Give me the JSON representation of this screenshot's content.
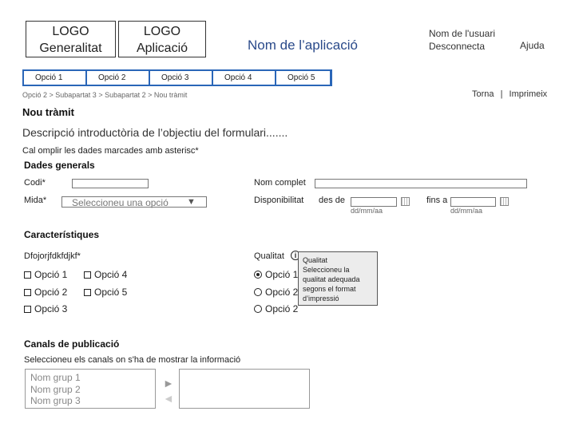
{
  "header": {
    "logo_generalitat": [
      "LOGO",
      "Generalitat"
    ],
    "logo_aplicacio": [
      "LOGO",
      "Aplicació"
    ],
    "app_name": "Nom de l’aplicació",
    "user_name": "Nom de l'usuari",
    "logout": "Desconnecta",
    "help": "Ajuda"
  },
  "nav": {
    "items": [
      "Opció 1",
      "Opció 2",
      "Opció 3",
      "Opció 4",
      "Opció 5"
    ]
  },
  "breadcrumb": "Opció 2 > Subapartat 3 > Subapartat 2 > Nou tràmit",
  "actions": {
    "back": "Torna",
    "separator": "|",
    "print": "Imprimeix"
  },
  "page": {
    "title": "Nou tràmit",
    "intro": "Descripció introductòria de l’objectiu del formulari.......",
    "required_note": "Cal omplir les dades marcades amb asterisc*"
  },
  "general": {
    "heading": "Dades generals",
    "codi_label": "Codi*",
    "nom_label": "Nom complet",
    "mida_label": "Mida*",
    "mida_placeholder": "Seleccioneu una opció",
    "select_arrow": "▼",
    "disponibilitat_label": "Disponibilitat",
    "des_de": "des de",
    "fins_a": "fins a",
    "date_hint": "dd/mm/aa"
  },
  "features": {
    "heading": "Característiques",
    "checkbox_group_label": "Dfojorjfdkfdjkf*",
    "checkboxes": [
      "Opció 1",
      "Opció 2",
      "Opció 3",
      "Opció 4",
      "Opció 5"
    ],
    "qualitat_label": "Qualitat",
    "info_glyph": "i",
    "radios": [
      "Opció 1",
      "Opció 2",
      "Opció 2"
    ],
    "tooltip_title": "Qualitat",
    "tooltip_text": "Seleccioneu la qualitat adequada segons el format d’impressió"
  },
  "channels": {
    "heading": "Canals de publicació",
    "instruction": "Seleccioneu els canals on s'ha de mostrar la informació",
    "groups": [
      "Nom grup 1",
      "Nom grup 2",
      "Nom grup 3"
    ],
    "move_right": "►",
    "move_left": "◄"
  }
}
